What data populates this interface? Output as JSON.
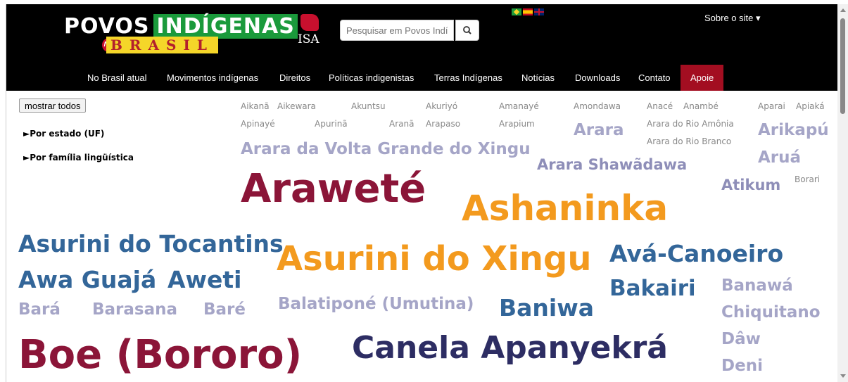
{
  "header": {
    "logo_text_1": "POVOS",
    "logo_text_2": "INDÍGENAS",
    "logo_text_3": "BRASIL",
    "logo_no": "NO",
    "isa_label": "ISA",
    "search_placeholder": "Pesquisar em Povos Indígenas",
    "about_menu": "Sobre o site ▾",
    "languages": [
      "pt",
      "es",
      "en"
    ]
  },
  "nav": {
    "items": [
      "No Brasil atual",
      "Movimentos indígenas",
      "Direitos",
      "Políticas indigenistas",
      "Terras Indígenas",
      "Notícias",
      "Downloads",
      "Contato",
      "Apoie"
    ],
    "active": "Apoie",
    "active_color": "#a30e21"
  },
  "sidebar": {
    "show_all": "mostrar todos",
    "filter_state": "►Por estado (UF)",
    "filter_family": "►Por família lingüística"
  },
  "cloud": {
    "peoples": [
      "Aikanã",
      "Aikewara",
      "Akuntsu",
      "Akuriyó",
      "Amanayé",
      "Amondawa",
      "Anacé",
      "Anambé",
      "Aparai",
      "Apiaká",
      "Apinayé",
      "Apurinã",
      "Aranã",
      "Arapaso",
      "Arapium",
      "Arara",
      "Arara do Rio Amônia",
      "Arara do Rio Branco",
      "Arikapú",
      "Arara da Volta Grande do Xingu",
      "Aruá",
      "Arara Shawãdawa",
      "Atikum",
      "Borari",
      "Araweté",
      "Ashaninka",
      "Asurini do Tocantins",
      "Asurini do Xingu",
      "Avá-Canoeiro",
      "Awa Guajá",
      "Aweti",
      "Bakairi",
      "Banawá",
      "Bará",
      "Barasana",
      "Baré",
      "Balatiponé (Umutina)",
      "Baniwa",
      "Chiquitano",
      "Dâw",
      "Boe (Bororo)",
      "Canela Apanyekrá",
      "Deni"
    ]
  },
  "colors": {
    "header_bg": "#000000",
    "blue": "#336699",
    "orange": "#f39a1e",
    "maroon": "#8b1538",
    "navy": "#2d2d63",
    "lavender": "#a5a5c7"
  }
}
